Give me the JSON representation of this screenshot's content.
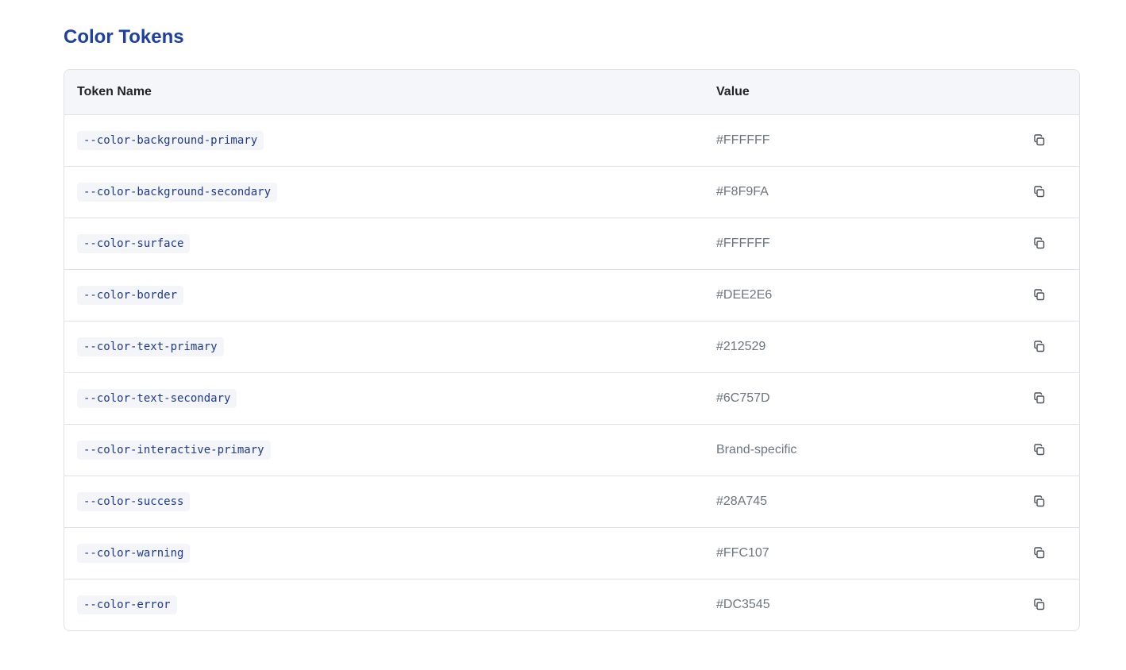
{
  "page": {
    "title": "Color Tokens"
  },
  "table": {
    "headers": {
      "name": "Token Name",
      "value": "Value"
    },
    "rows": [
      {
        "name": "--color-background-primary",
        "value": "#FFFFFF"
      },
      {
        "name": "--color-background-secondary",
        "value": "#F8F9FA"
      },
      {
        "name": "--color-surface",
        "value": "#FFFFFF"
      },
      {
        "name": "--color-border",
        "value": "#DEE2E6"
      },
      {
        "name": "--color-text-primary",
        "value": "#212529"
      },
      {
        "name": "--color-text-secondary",
        "value": "#6C757D"
      },
      {
        "name": "--color-interactive-primary",
        "value": "Brand-specific"
      },
      {
        "name": "--color-success",
        "value": "#28A745"
      },
      {
        "name": "--color-warning",
        "value": "#FFC107"
      },
      {
        "name": "--color-error",
        "value": "#DC3545"
      }
    ],
    "row_action_icon": "copy-icon"
  },
  "colors": {
    "title": "#1E40A0",
    "code_text": "#1E3A8A",
    "code_background": "#F4F5F8",
    "header_background": "#F5F6F9",
    "border": "#DEE2E6",
    "value_text": "#6C757D"
  }
}
